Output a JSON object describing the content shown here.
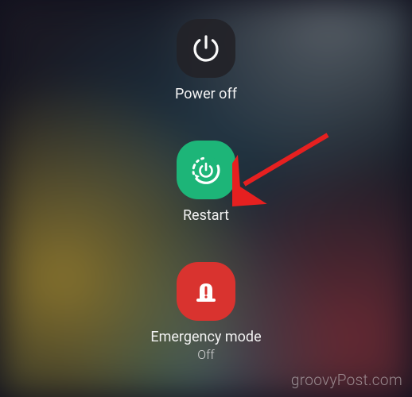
{
  "menu": {
    "power_off": {
      "label": "Power off",
      "icon": "power-icon"
    },
    "restart": {
      "label": "Restart",
      "icon": "restart-icon",
      "highlight_color": "#1db578"
    },
    "emergency": {
      "label": "Emergency mode",
      "sublabel": "Off",
      "icon": "emergency-icon",
      "color": "#d9332f"
    }
  },
  "annotation": {
    "arrow_color": "#e62020"
  },
  "watermark": "groovyPost.com"
}
